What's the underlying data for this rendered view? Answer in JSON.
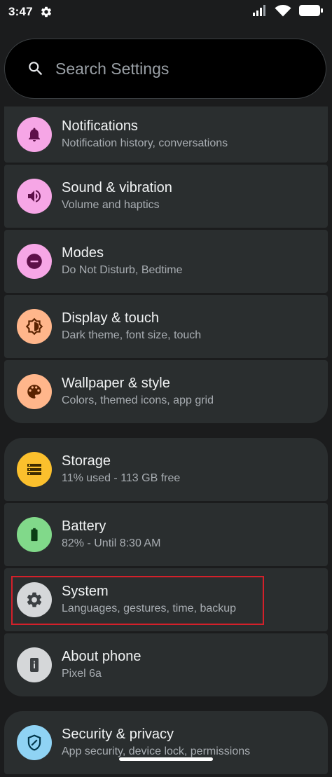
{
  "status_bar": {
    "time": "3:47",
    "icons": [
      "settings-gear-icon",
      "signal-icon",
      "wifi-icon",
      "battery-icon"
    ]
  },
  "search": {
    "placeholder": "Search Settings",
    "icon": "search-icon"
  },
  "groups": [
    {
      "items": [
        {
          "id": "notifications",
          "title": "Notifications",
          "subtitle": "Notification history, conversations",
          "icon": "bell-icon",
          "color": "#f6a6e6"
        },
        {
          "id": "sound",
          "title": "Sound & vibration",
          "subtitle": "Volume and haptics",
          "icon": "speaker-icon",
          "color": "#f6a6e6"
        },
        {
          "id": "modes",
          "title": "Modes",
          "subtitle": "Do Not Disturb, Bedtime",
          "icon": "minus-circle-icon",
          "color": "#f6a6e6"
        },
        {
          "id": "display",
          "title": "Display & touch",
          "subtitle": "Dark theme, font size, touch",
          "icon": "brightness-icon",
          "color": "#ffb68b"
        },
        {
          "id": "wallpaper",
          "title": "Wallpaper & style",
          "subtitle": "Colors, themed icons, app grid",
          "icon": "palette-icon",
          "color": "#ffb68b"
        }
      ]
    },
    {
      "items": [
        {
          "id": "storage",
          "title": "Storage",
          "subtitle": "11% used - 113 GB free",
          "icon": "storage-icon",
          "color": "#fbc02d"
        },
        {
          "id": "battery",
          "title": "Battery",
          "subtitle": "82% - Until 8:30 AM",
          "icon": "battery-icon",
          "color": "#81d98a"
        },
        {
          "id": "system",
          "title": "System",
          "subtitle": "Languages, gestures, time, backup",
          "icon": "gear-icon",
          "color": "#d5d7d9"
        },
        {
          "id": "about",
          "title": "About phone",
          "subtitle": "Pixel 6a",
          "icon": "info-phone-icon",
          "color": "#d5d7d9"
        }
      ]
    },
    {
      "items": [
        {
          "id": "security",
          "title": "Security & privacy",
          "subtitle": "App security, device lock, permissions",
          "icon": "shield-icon",
          "color": "#8fd3f4"
        }
      ]
    }
  ],
  "colors": {
    "background": "#1b1c1d",
    "card": "#2a2e2f",
    "highlight_border": "#d4202a"
  }
}
